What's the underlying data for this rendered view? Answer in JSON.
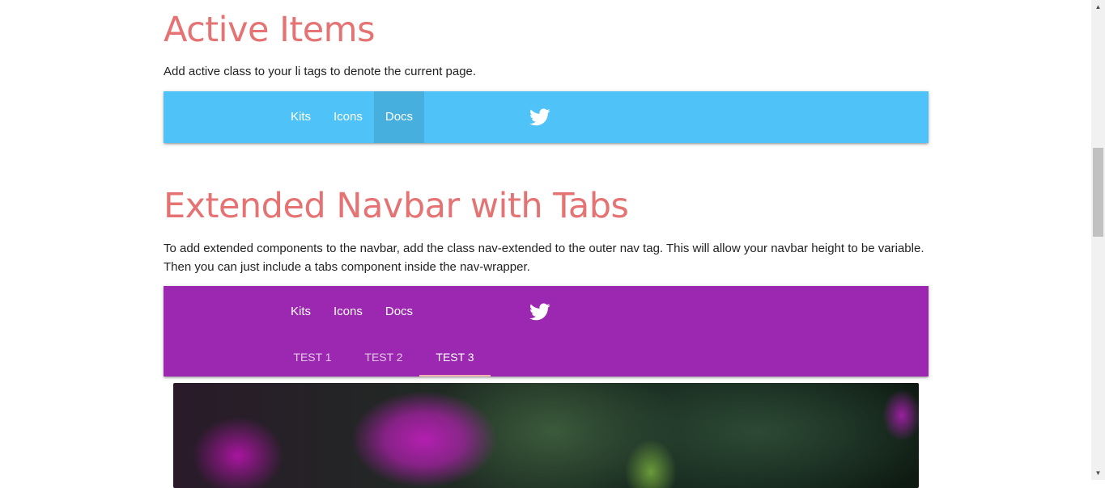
{
  "active_section": {
    "title": "Active Items",
    "description": "Add active class to your li tags to denote the current page.",
    "navbar": {
      "color": "#4fc3f7",
      "links": [
        "Kits",
        "Icons",
        "Docs"
      ],
      "active_link": "Docs",
      "icon": "twitter-icon"
    }
  },
  "extended_section": {
    "title": "Extended Navbar with Tabs",
    "description_line1": "To add extended components to the navbar, add the class nav-extended to the outer nav tag. This will allow your navbar height to be variable.",
    "description_line2": "Then you can just include a tabs component inside the nav-wrapper.",
    "navbar": {
      "color": "#9c27b0",
      "links": [
        "Kits",
        "Icons",
        "Docs"
      ],
      "icon": "twitter-icon",
      "tabs": [
        "Test 1",
        "Test 2",
        "Test 3"
      ],
      "active_tab": "Test 3"
    }
  },
  "colors": {
    "heading": "#e57373",
    "tab_indicator": "#f6b2b5"
  }
}
